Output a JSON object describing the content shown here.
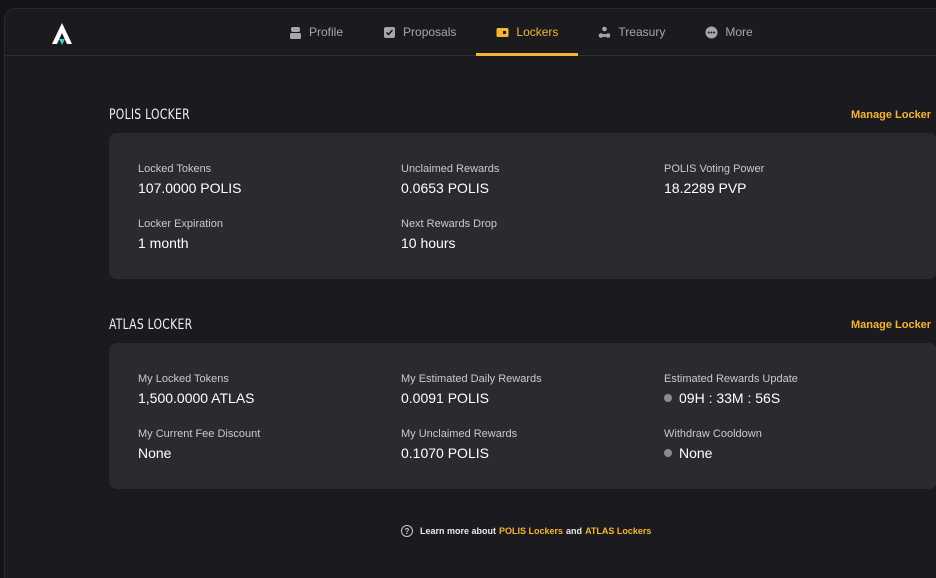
{
  "nav": {
    "items": [
      {
        "label": "Profile",
        "icon": "profile-icon",
        "active": false
      },
      {
        "label": "Proposals",
        "icon": "proposals-icon",
        "active": false
      },
      {
        "label": "Lockers",
        "icon": "lockers-icon",
        "active": true
      },
      {
        "label": "Treasury",
        "icon": "treasury-icon",
        "active": false
      },
      {
        "label": "More",
        "icon": "more-icon",
        "active": false
      }
    ]
  },
  "polis": {
    "title": "POLIS LOCKER",
    "manage_label": "Manage Locker",
    "stats": {
      "locked_tokens": {
        "label": "Locked Tokens",
        "value": "107.0000 POLIS"
      },
      "unclaimed_rewards": {
        "label": "Unclaimed Rewards",
        "value": "0.0653 POLIS"
      },
      "voting_power": {
        "label": "POLIS Voting Power",
        "value": "18.2289 PVP"
      },
      "expiration": {
        "label": "Locker Expiration",
        "value": "1 month"
      },
      "next_drop": {
        "label": "Next Rewards Drop",
        "value": "10 hours"
      }
    }
  },
  "atlas": {
    "title": "ATLAS LOCKER",
    "manage_label": "Manage Locker",
    "stats": {
      "my_locked": {
        "label": "My Locked Tokens",
        "value": "1,500.0000 ATLAS"
      },
      "daily_rewards": {
        "label": "My Estimated Daily Rewards",
        "value": "0.0091 POLIS"
      },
      "rewards_update": {
        "label": "Estimated Rewards Update",
        "value": "09H : 33M : 56S"
      },
      "fee_discount": {
        "label": "My Current Fee Discount",
        "value": "None"
      },
      "unclaimed": {
        "label": "My Unclaimed Rewards",
        "value": "0.1070 POLIS"
      },
      "cooldown": {
        "label": "Withdraw Cooldown",
        "value": "None"
      }
    }
  },
  "footer": {
    "prefix": "Learn more about",
    "polis_link": "POLIS Lockers",
    "and": "and",
    "atlas_link": "ATLAS Lockers"
  },
  "colors": {
    "accent": "#f5b533",
    "background": "#1b1b1f",
    "card": "#2a2a30"
  }
}
